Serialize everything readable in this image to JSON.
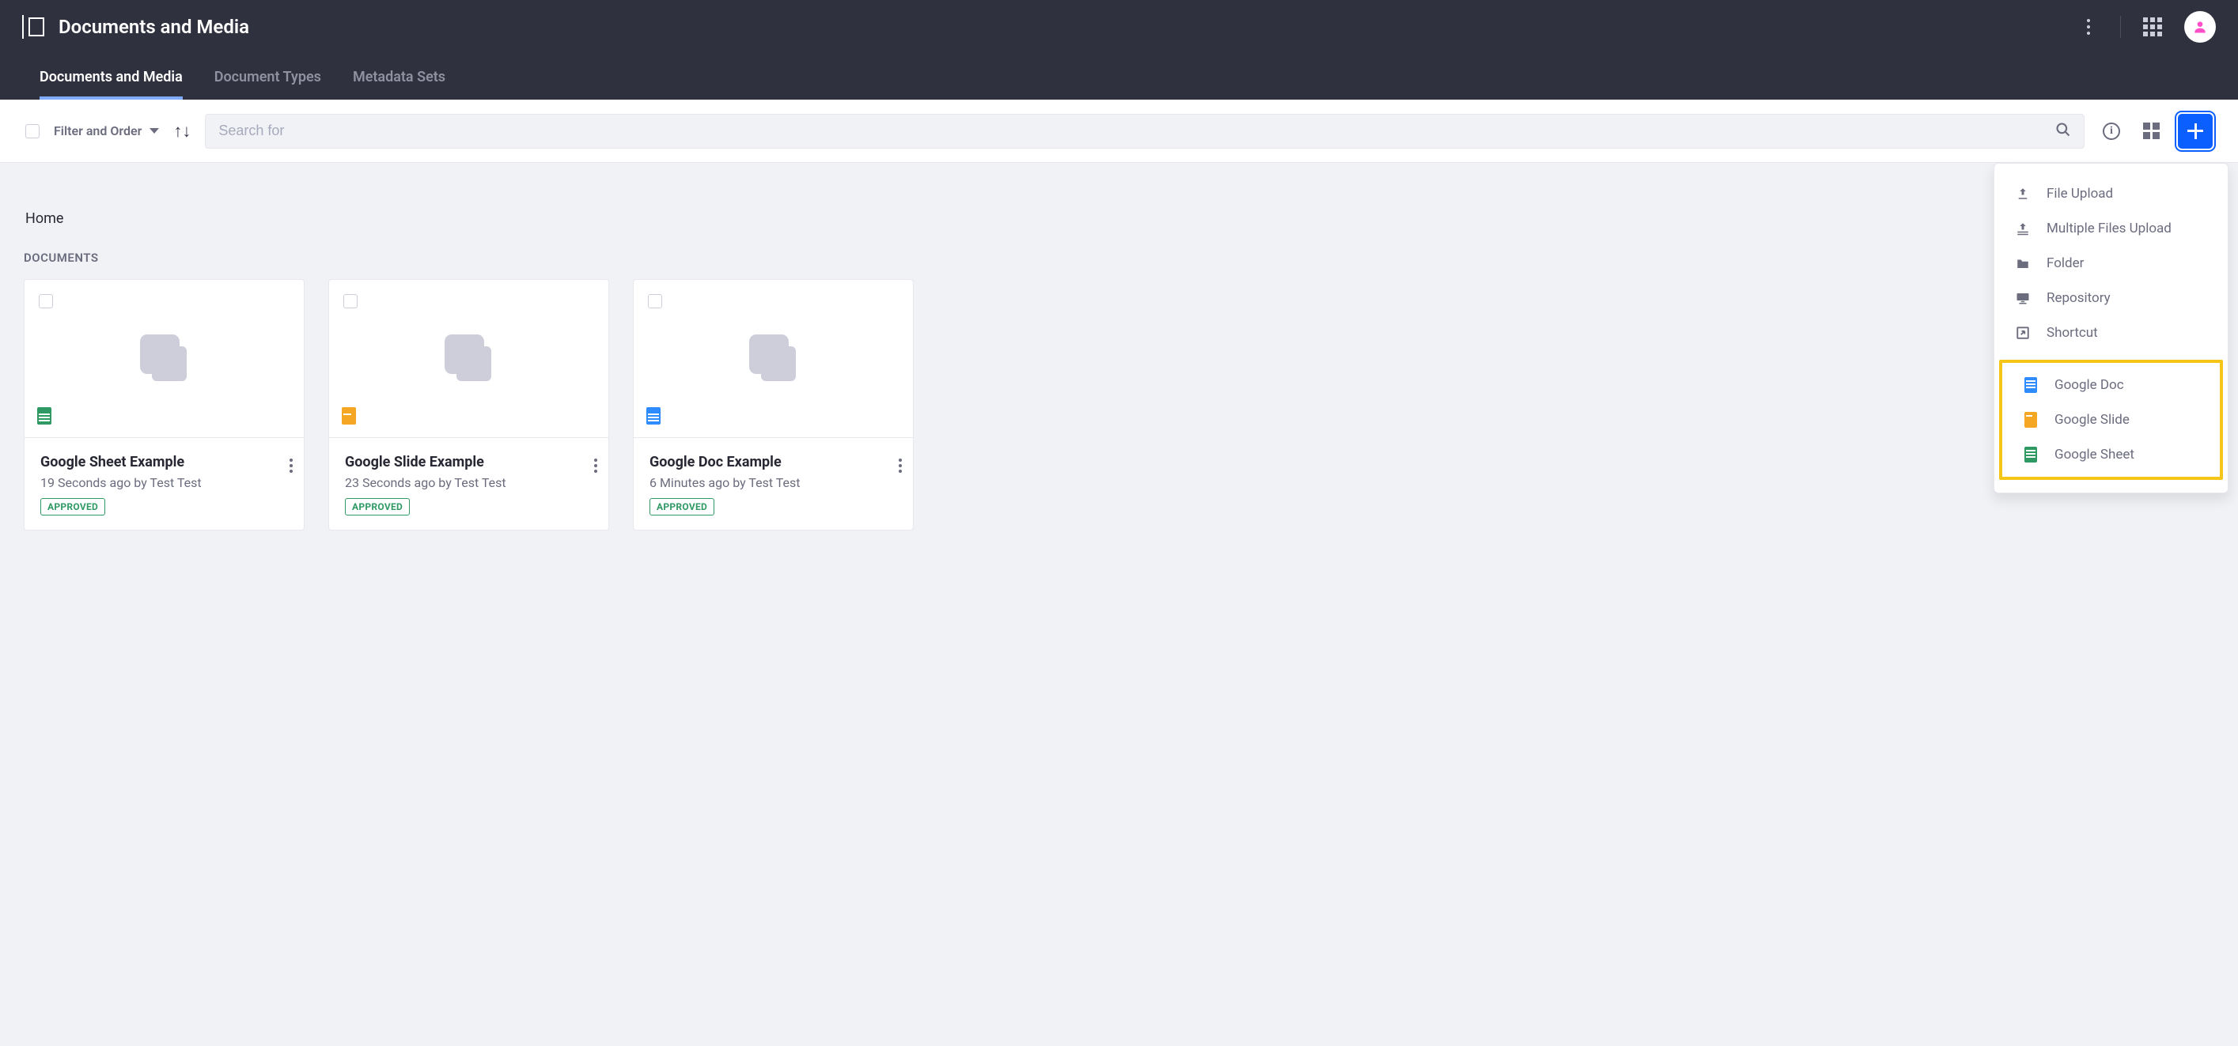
{
  "header": {
    "title": "Documents and Media"
  },
  "tabs": [
    {
      "label": "Documents and Media",
      "active": true
    },
    {
      "label": "Document Types",
      "active": false
    },
    {
      "label": "Metadata Sets",
      "active": false
    }
  ],
  "toolbar": {
    "filter_label": "Filter and Order",
    "search_placeholder": "Search for"
  },
  "breadcrumb": "Home",
  "section_label": "Documents",
  "documents": [
    {
      "title": "Google Sheet Example",
      "subtitle": "19 Seconds ago by Test Test",
      "status": "APPROVED",
      "type": "sheet"
    },
    {
      "title": "Google Slide Example",
      "subtitle": "23 Seconds ago by Test Test",
      "status": "APPROVED",
      "type": "slide"
    },
    {
      "title": "Google Doc Example",
      "subtitle": "6 Minutes ago by Test Test",
      "status": "APPROVED",
      "type": "doc"
    }
  ],
  "add_menu": {
    "items": [
      {
        "label": "File Upload",
        "icon": "upload"
      },
      {
        "label": "Multiple Files Upload",
        "icon": "multi-upload"
      },
      {
        "label": "Folder",
        "icon": "folder"
      },
      {
        "label": "Repository",
        "icon": "repository"
      },
      {
        "label": "Shortcut",
        "icon": "shortcut"
      }
    ],
    "google_items": [
      {
        "label": "Google Doc",
        "icon": "gdoc"
      },
      {
        "label": "Google Slide",
        "icon": "gslide"
      },
      {
        "label": "Google Sheet",
        "icon": "gsheet"
      }
    ]
  }
}
